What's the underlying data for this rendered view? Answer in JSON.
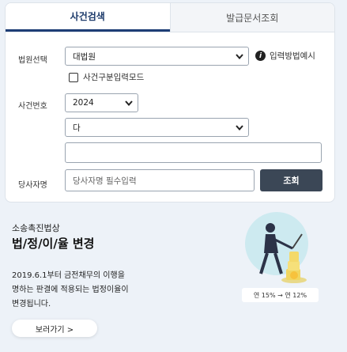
{
  "tabs": [
    {
      "label": "사건검색"
    },
    {
      "label": "발급문서조회"
    }
  ],
  "form": {
    "court_label": "법원선택",
    "court_value": "대법원",
    "info_link": "입력방법예시",
    "case_mode_label": "사건구분입력모드",
    "case_no_label": "사건번호",
    "year_value": "2024",
    "case_type_value": "다",
    "case_serial_value": "",
    "party_label": "당사자명",
    "party_placeholder": "당사자명 필수입력",
    "search_button": "조회"
  },
  "promo": {
    "subtitle": "소송촉진법상",
    "title": "법/정/이/율 변경",
    "description": [
      "2019.6.1부터 금전채무의 이행을",
      "명하는 판결에 적용되는 법정이율이",
      "변경됩니다."
    ],
    "more_button": "보러가기 >",
    "rate_badge": "연 15% → 연 12%"
  },
  "colors": {
    "accent": "#1e3d75",
    "search_button": "#3b4756",
    "background": "#edf2f8"
  }
}
